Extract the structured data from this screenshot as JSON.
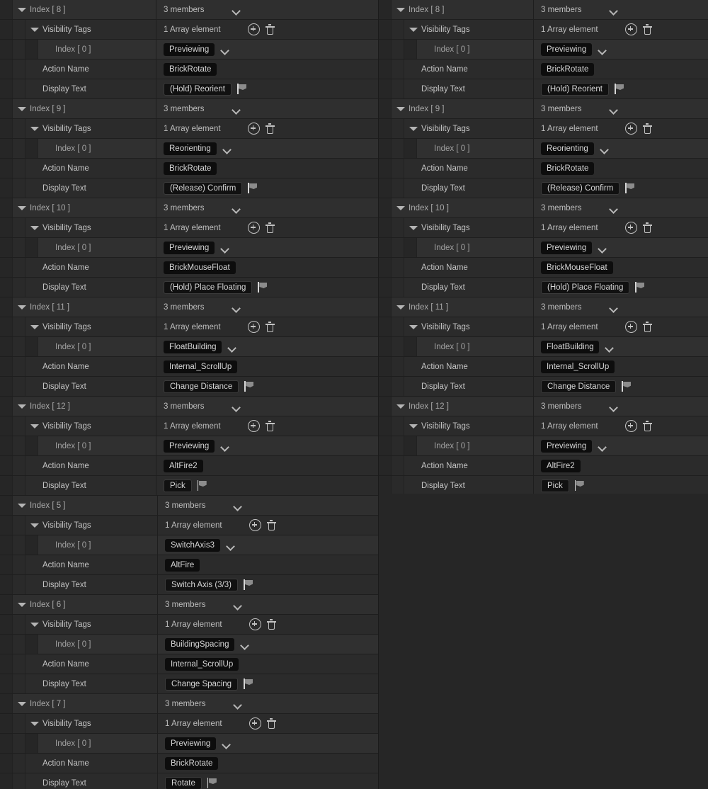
{
  "icons": {
    "expand_arrow": "triangle-down-icon",
    "combo_chevron": "chevron-down-icon",
    "add": "add-array-element-icon",
    "delete": "delete-array-icon",
    "flag": "localization-flag-icon"
  },
  "labels": {
    "visibility_tags": "Visibility Tags",
    "action_name": "Action Name",
    "display_text": "Display Text",
    "three_members": "3 members",
    "one_array_element": "1 Array element",
    "index_0": "Index [ 0 ]"
  },
  "colors": {
    "window_bg": "#242424",
    "row_bg": "#2b2b2b",
    "row_header_bg": "#2f2f2f",
    "chip_bg": "#0d0d0d",
    "text": "#c8c8c8",
    "divider": "#1e1e1e"
  },
  "panels": [
    {
      "id": "left",
      "groups": [
        {
          "index_label": "Index [ 8 ]",
          "members": "3 members",
          "tag": "Previewing",
          "action": "BrickRotate",
          "display": "(Hold) Reorient"
        },
        {
          "index_label": "Index [ 9 ]",
          "members": "3 members",
          "tag": "Reorienting",
          "action": "BrickRotate",
          "display": "(Release) Confirm"
        },
        {
          "index_label": "Index [ 10 ]",
          "members": "3 members",
          "tag": "Previewing",
          "action": "BrickMouseFloat",
          "display": "(Hold) Place Floating"
        },
        {
          "index_label": "Index [ 11 ]",
          "members": "3 members",
          "tag": "FloatBuilding",
          "action": "Internal_ScrollUp",
          "display": "Change Distance"
        },
        {
          "index_label": "Index [ 12 ]",
          "members": "3 members",
          "tag": "Previewing",
          "action": "AltFire2",
          "display": "Pick"
        },
        {
          "index_label": "Index [ 5 ]",
          "members": "3 members",
          "tag": "SwitchAxis3",
          "action": "AltFire",
          "display": "Switch Axis (3/3)"
        },
        {
          "index_label": "Index [ 6 ]",
          "members": "3 members",
          "tag": "BuildingSpacing",
          "action": "Internal_ScrollUp",
          "display": "Change Spacing"
        },
        {
          "index_label": "Index [ 7 ]",
          "members": "3 members",
          "tag": "Previewing",
          "action": "BrickRotate",
          "display": "Rotate"
        }
      ]
    },
    {
      "id": "right",
      "groups": [
        {
          "index_label": "Index [ 8 ]",
          "members": "3 members",
          "tag": "Previewing",
          "action": "BrickRotate",
          "display": "(Hold) Reorient"
        },
        {
          "index_label": "Index [ 9 ]",
          "members": "3 members",
          "tag": "Reorienting",
          "action": "BrickRotate",
          "display": "(Release) Confirm"
        },
        {
          "index_label": "Index [ 10 ]",
          "members": "3 members",
          "tag": "Previewing",
          "action": "BrickMouseFloat",
          "display": "(Hold) Place Floating"
        },
        {
          "index_label": "Index [ 11 ]",
          "members": "3 members",
          "tag": "FloatBuilding",
          "action": "Internal_ScrollUp",
          "display": "Change Distance"
        },
        {
          "index_label": "Index [ 12 ]",
          "members": "3 members",
          "tag": "Previewing",
          "action": "AltFire2",
          "display": "Pick"
        }
      ]
    }
  ]
}
